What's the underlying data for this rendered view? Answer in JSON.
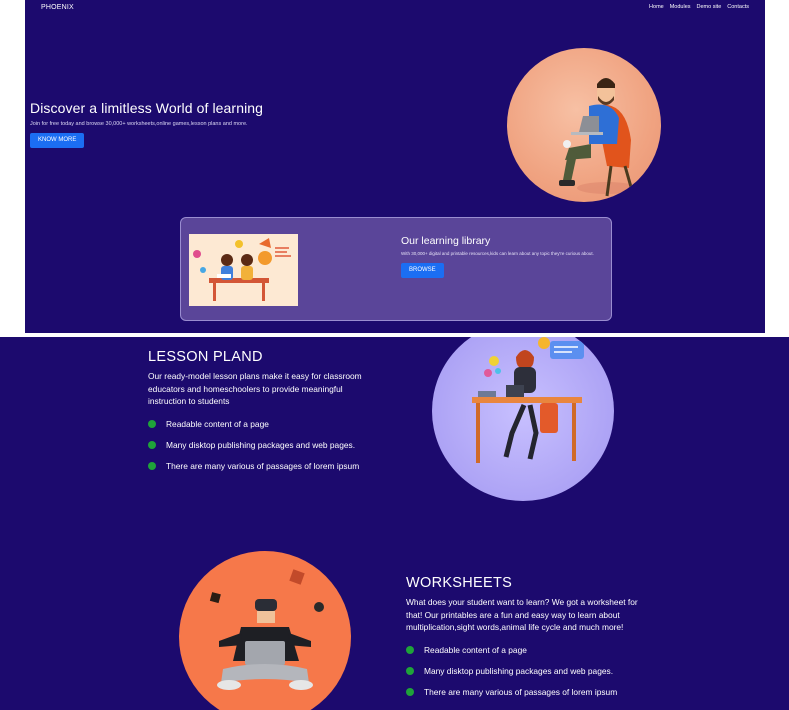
{
  "navbar": {
    "brand": "PHOENIX",
    "links": [
      "Home",
      "Modules",
      "Demo site",
      "Contacts"
    ]
  },
  "hero": {
    "title": "Discover a limitless World of learning",
    "subtitle": "Join for free today and browse 30,000+ worksheets,online games,lesson plans and more.",
    "button": "KNOW MORE"
  },
  "library": {
    "title": "Our learning library",
    "description": "With 30,000+ digital and printable resources,kids can learn about any topic they're curious about.",
    "button": "BROWSE"
  },
  "lesson": {
    "title": "LESSON PLAND",
    "description": "Our ready-model lesson plans make it easy for classroom educators and homeschoolers to provide meaningful instruction to students",
    "bullets": [
      "Readable content of a page",
      "Many disktop publishing packages and web pages.",
      "There are many various of passages of lorem ipsum"
    ]
  },
  "worksheets": {
    "title": "WORKSHEETS",
    "description": "What does your student want to learn? We got a worksheet for that! Our printables are a fun and easy way to learn about multiplication,sight words,animal life cycle and much more!",
    "bullets": [
      "Readable content of a page",
      "Many disktop publishing packages and web pages.",
      "There are many various of passages of lorem ipsum"
    ]
  },
  "colors": {
    "background": "#1c0a6e",
    "button": "#1b6ef3",
    "card": "#5a4599",
    "bullet": "#1fa33a",
    "hero_circle": "#f0a381",
    "lesson_circle": "#ada3f5",
    "worksheets_circle": "#f6784a"
  }
}
